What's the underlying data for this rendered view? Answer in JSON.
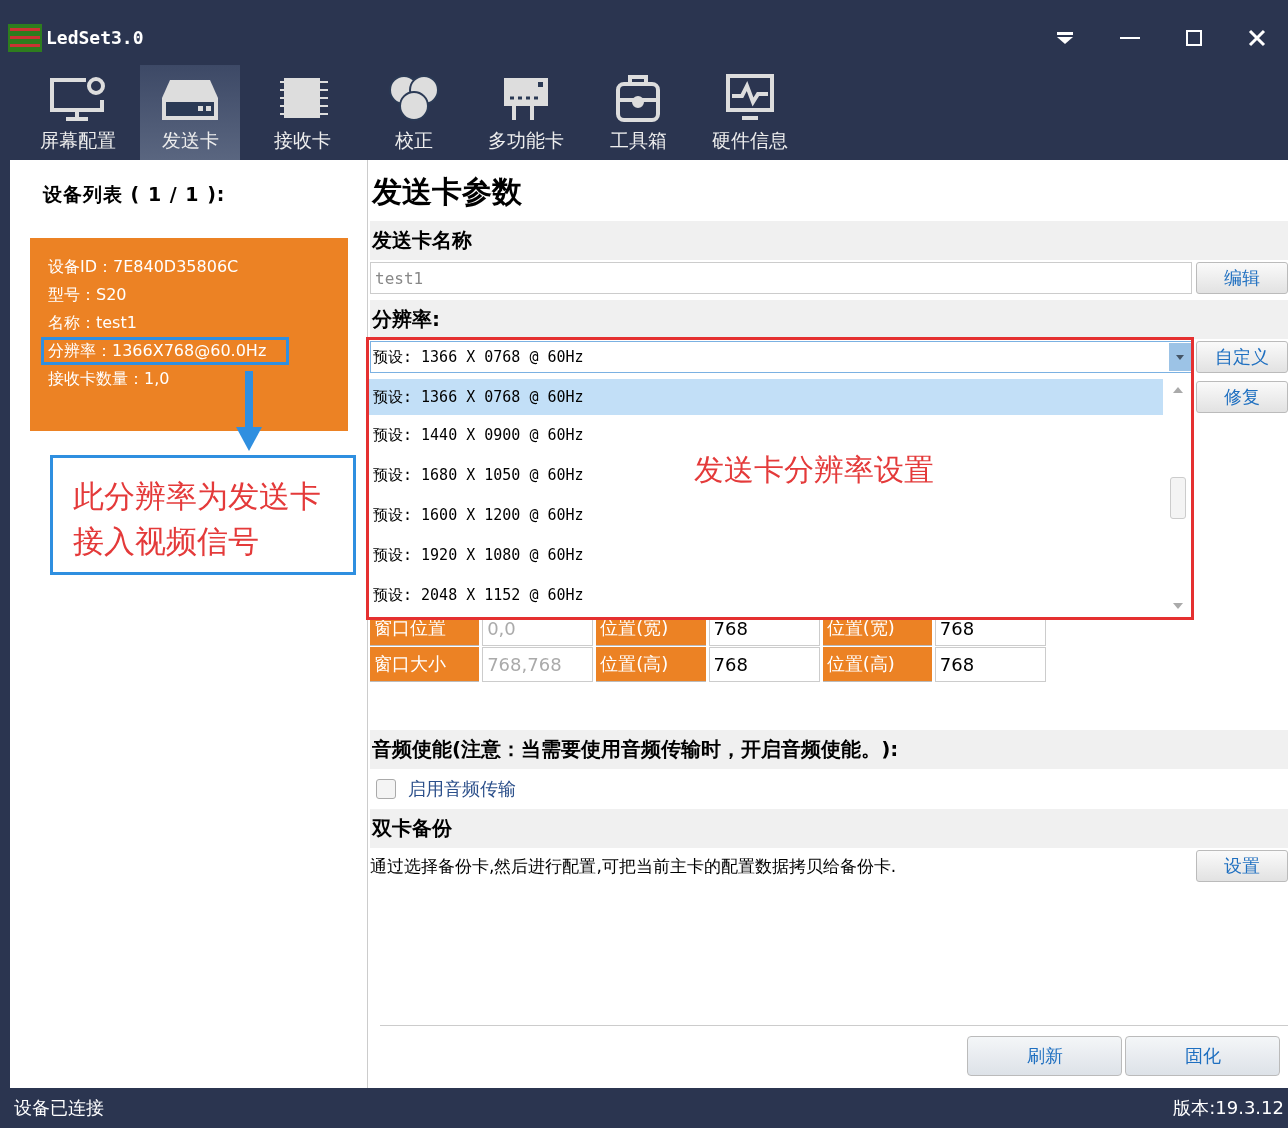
{
  "window": {
    "title": "LedSet3.0"
  },
  "toolbar": [
    {
      "label": "屏幕配置",
      "selected": false
    },
    {
      "label": "发送卡",
      "selected": true
    },
    {
      "label": "接收卡",
      "selected": false
    },
    {
      "label": "校正",
      "selected": false
    },
    {
      "label": "多功能卡",
      "selected": false
    },
    {
      "label": "工具箱",
      "selected": false
    },
    {
      "label": "硬件信息",
      "selected": false
    }
  ],
  "device_list": {
    "title": "设备列表 ( 1 / 1 ):",
    "lines": [
      {
        "text": "设备ID：7E840D35806C",
        "highlighted": false
      },
      {
        "text": "型号：S20",
        "highlighted": false
      },
      {
        "text": "名称：test1",
        "highlighted": false
      },
      {
        "text": "分辨率：1366X768@60.0Hz",
        "highlighted": true
      },
      {
        "text": "接收卡数量：1,0",
        "highlighted": false
      }
    ],
    "note": [
      "此分辨率为发送卡",
      "接入视频信号"
    ]
  },
  "params": {
    "title": "发送卡参数",
    "name": {
      "label": "发送卡名称",
      "value": "test1",
      "button": "编辑"
    },
    "resolution": {
      "label": "分辨率:",
      "value": "预设: 1366 X 0768 @ 60Hz",
      "buttons": [
        "自定义",
        "修复"
      ],
      "options": [
        {
          "label": "预设: 1366 X 0768 @ 60Hz",
          "selected": true
        },
        {
          "label": "预设: 1440 X 0900 @ 60Hz",
          "selected": false
        },
        {
          "label": "预设: 1680 X 1050 @ 60Hz",
          "selected": false
        },
        {
          "label": "预设: 1600 X 1200 @ 60Hz",
          "selected": false
        },
        {
          "label": "预设: 1920 X 1080 @ 60Hz",
          "selected": false
        },
        {
          "label": "预设: 2048 X 1152 @ 60Hz",
          "selected": false
        }
      ],
      "note": "发送卡分辨率设置"
    },
    "window_table": [
      [
        "窗口位置",
        "0,0",
        "位置(宽)",
        "768",
        "位置(宽)",
        "768"
      ],
      [
        "窗口大小",
        "768,768",
        "位置(高)",
        "768",
        "位置(高)",
        "768"
      ]
    ],
    "audio": {
      "label": "音频使能(注意：当需要使用音频传输时，开启音频使能。):",
      "option": {
        "label": "启用音频传输",
        "checked": false
      }
    },
    "backup": {
      "label": "双卡备份",
      "description": "通过选择备份卡,然后进行配置,可把当前主卡的配置数据拷贝给备份卡.",
      "button": "设置"
    },
    "actions": [
      "刷新",
      "固化"
    ]
  },
  "status_bar": {
    "left": "设备已连接",
    "right": "版本:19.3.12"
  }
}
